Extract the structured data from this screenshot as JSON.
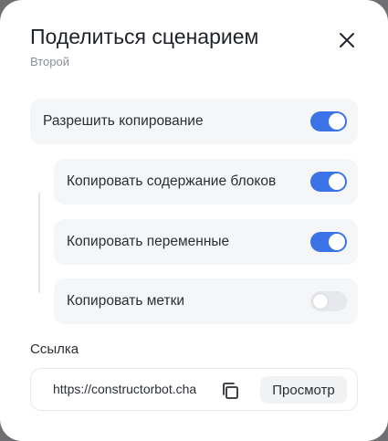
{
  "dialog": {
    "title": "Поделиться сценарием",
    "subtitle": "Второй"
  },
  "settings": {
    "allow_copy": {
      "label": "Разрешить копирование",
      "enabled": true
    },
    "items": [
      {
        "label": "Копировать содержание блоков",
        "enabled": true
      },
      {
        "label": "Копировать переменные",
        "enabled": true
      },
      {
        "label": "Копировать метки",
        "enabled": false
      }
    ]
  },
  "link": {
    "label": "Ссылка",
    "url": "https://constructorbot.cha",
    "preview_label": "Просмотр"
  },
  "icons": {
    "close": "close-icon",
    "copy": "copy-icon"
  },
  "colors": {
    "toggle_on": "#3b73e6",
    "toggle_off": "#e7e8eb"
  }
}
